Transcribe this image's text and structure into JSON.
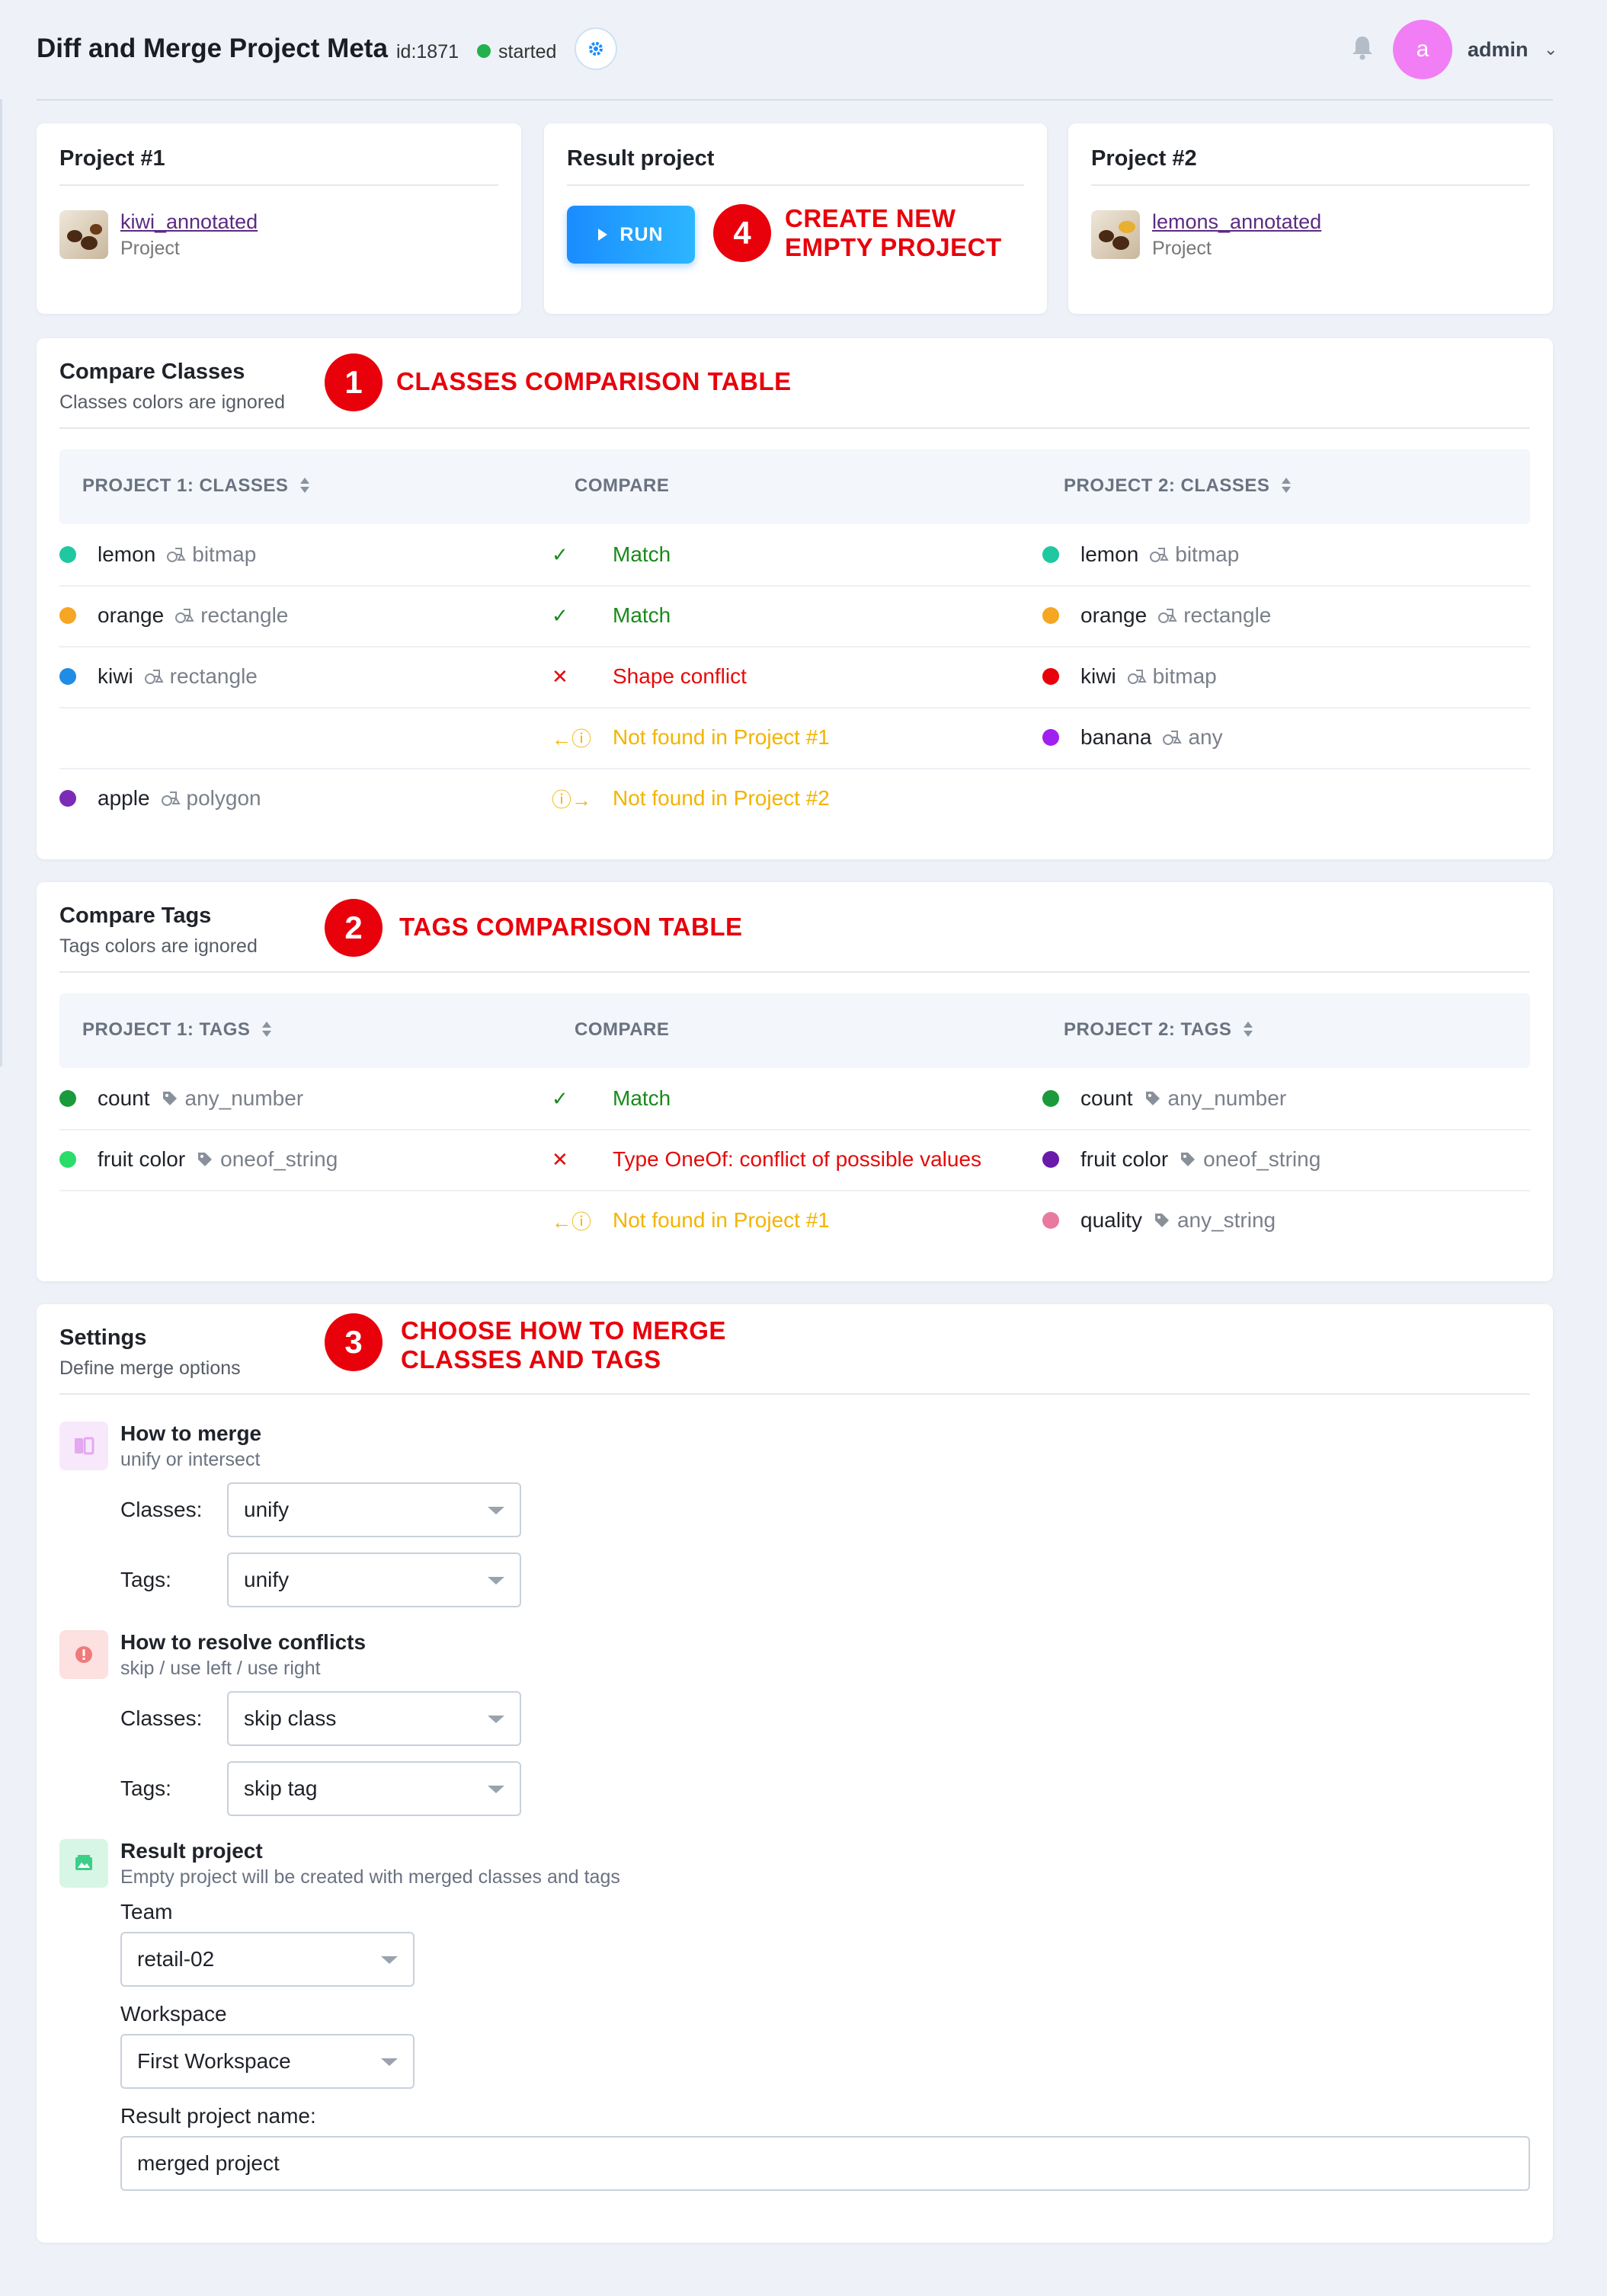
{
  "header": {
    "title": "Diff and Merge Project Meta",
    "task_id": "id:1871",
    "status": "started",
    "status_color": "#22b14c",
    "user_initial": "a",
    "user_name": "admin",
    "avatar_color": "#f17ef5"
  },
  "projects": {
    "left": {
      "heading": "Project #1",
      "name": "kiwi_annotated",
      "type": "Project"
    },
    "result": {
      "heading": "Result project",
      "run_label": "RUN"
    },
    "right": {
      "heading": "Project #2",
      "name": "lemons_annotated",
      "type": "Project"
    }
  },
  "annotations": {
    "a1": {
      "number": "1",
      "text": "CLASSES COMPARISON TABLE"
    },
    "a2": {
      "number": "2",
      "text": "TAGS COMPARISON TABLE"
    },
    "a3": {
      "number": "3",
      "line1": "CHOOSE HOW TO MERGE",
      "line2": "CLASSES AND TAGS"
    },
    "a4": {
      "number": "4",
      "line1": "CREATE NEW",
      "line2": "EMPTY PROJECT"
    }
  },
  "classes": {
    "title": "Compare Classes",
    "subtitle": "Classes colors are ignored",
    "columns": [
      "PROJECT 1: CLASSES",
      "COMPARE",
      "PROJECT 2: CLASSES"
    ],
    "rows": [
      {
        "left": {
          "name": "lemon",
          "shape": "bitmap",
          "color": "#1ec8a0"
        },
        "status": "Match",
        "kind": "ok",
        "icon": "✓",
        "right": {
          "name": "lemon",
          "shape": "bitmap",
          "color": "#1ec8a0"
        }
      },
      {
        "left": {
          "name": "orange",
          "shape": "rectangle",
          "color": "#f5a623"
        },
        "status": "Match",
        "kind": "ok",
        "icon": "✓",
        "right": {
          "name": "orange",
          "shape": "rectangle",
          "color": "#f5a623"
        }
      },
      {
        "left": {
          "name": "kiwi",
          "shape": "rectangle",
          "color": "#1f8de6"
        },
        "status": "Shape conflict",
        "kind": "bad",
        "icon": "✕",
        "right": {
          "name": "kiwi",
          "shape": "bitmap",
          "color": "#e8000b"
        }
      },
      {
        "left": null,
        "status": "Not found in Project #1",
        "kind": "warn",
        "icon": "←ⓘ",
        "right": {
          "name": "banana",
          "shape": "any",
          "color": "#a020f0"
        }
      },
      {
        "left": {
          "name": "apple",
          "shape": "polygon",
          "color": "#7b2bb5"
        },
        "status": "Not found in Project #2",
        "kind": "warn",
        "icon": "ⓘ→",
        "right": null
      }
    ]
  },
  "tags": {
    "title": "Compare Tags",
    "subtitle": "Tags colors are ignored",
    "columns": [
      "PROJECT 1: TAGS",
      "COMPARE",
      "PROJECT 2: TAGS"
    ],
    "rows": [
      {
        "left": {
          "name": "count",
          "type": "any_number",
          "color": "#1a9a3a"
        },
        "status": "Match",
        "kind": "ok",
        "icon": "✓",
        "right": {
          "name": "count",
          "type": "any_number",
          "color": "#1a9a3a"
        }
      },
      {
        "left": {
          "name": "fruit color",
          "type": "oneof_string",
          "color": "#2bdc6a"
        },
        "status": "Type OneOf: conflict of possible values",
        "kind": "bad",
        "icon": "✕",
        "right": {
          "name": "fruit color",
          "type": "oneof_string",
          "color": "#6a1aa8"
        }
      },
      {
        "left": null,
        "status": "Not found in Project #1",
        "kind": "warn",
        "icon": "←ⓘ",
        "right": {
          "name": "quality",
          "type": "any_string",
          "color": "#e87aa0"
        }
      }
    ]
  },
  "settings": {
    "title": "Settings",
    "subtitle": "Define merge options",
    "merge": {
      "title": "How to merge",
      "subtitle": "unify or intersect",
      "classes_label": "Classes:",
      "classes_value": "unify",
      "tags_label": "Tags:",
      "tags_value": "unify"
    },
    "conflicts": {
      "title": "How to resolve conflicts",
      "subtitle": "skip / use left / use right",
      "classes_label": "Classes:",
      "classes_value": "skip class",
      "tags_label": "Tags:",
      "tags_value": "skip tag"
    },
    "result": {
      "title": "Result project",
      "subtitle": "Empty project will be created with merged classes and tags",
      "team_label": "Team",
      "team_value": "retail-02",
      "workspace_label": "Workspace",
      "workspace_value": "First Workspace",
      "name_label": "Result project name:",
      "name_value": "merged project"
    }
  }
}
